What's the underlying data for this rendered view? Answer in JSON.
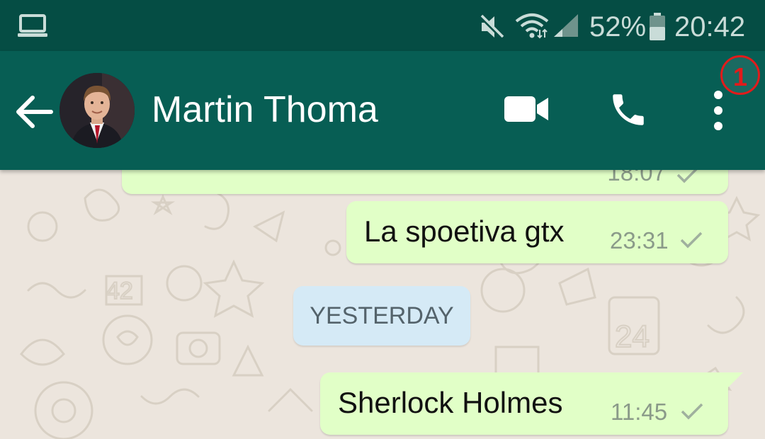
{
  "status_bar": {
    "battery_percent": "52%",
    "time": "20:42",
    "icons": [
      "laptop-icon",
      "mute-icon",
      "wifi-icon",
      "signal-icon",
      "battery-icon"
    ]
  },
  "toolbar": {
    "contact_name": "Martin Thoma",
    "badge": "1",
    "icons": [
      "back-arrow-icon",
      "video-call-icon",
      "phone-icon",
      "more-options-icon"
    ]
  },
  "chat": {
    "messages": [
      {
        "text": "",
        "time": "18:07",
        "status": "sent",
        "partially_visible": true
      },
      {
        "text": "La spoetiva gtx",
        "time": "23:31",
        "status": "sent"
      },
      {
        "text": "Sherlock Holmes",
        "time": "11:45",
        "status": "sent"
      }
    ],
    "date_separator": "YESTERDAY"
  },
  "colors": {
    "status_bar_bg": "#054d44",
    "toolbar_bg": "#075e54",
    "chat_bg": "#ece5dd",
    "outgoing_bubble": "#e1ffc7",
    "date_chip": "#d5eaf6",
    "badge": "#e21b1b"
  }
}
